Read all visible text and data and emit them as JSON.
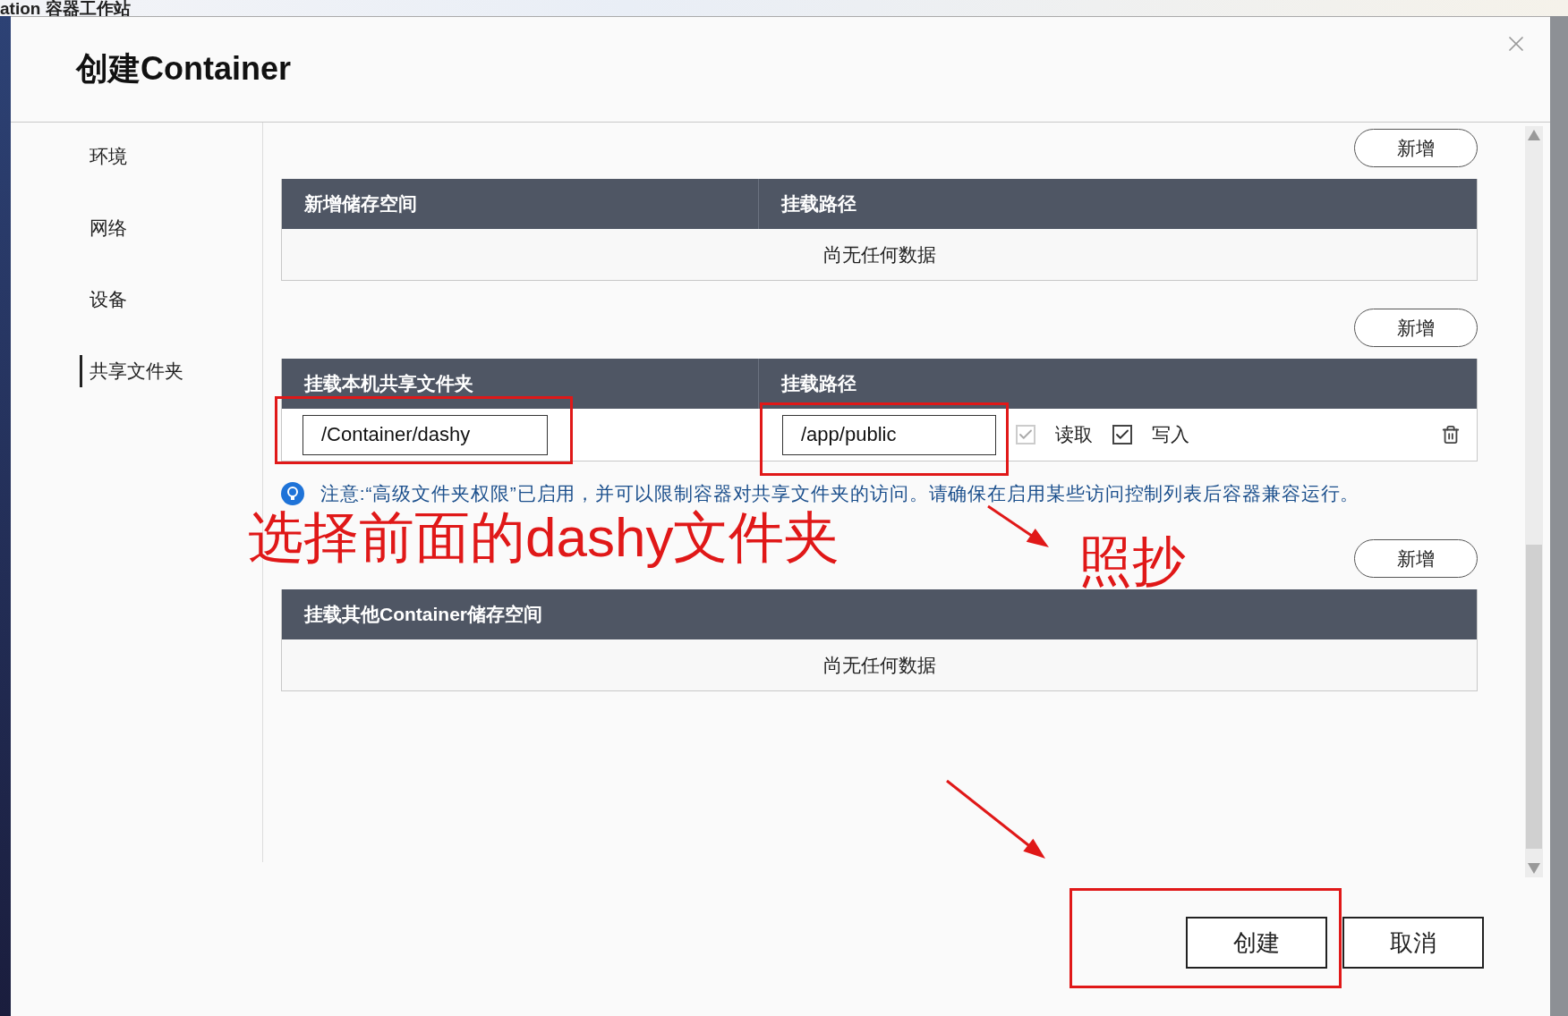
{
  "background_title": "ation 容器工作站",
  "dialog": {
    "title": "创建Container"
  },
  "sidebar": {
    "items": [
      {
        "label": "环境",
        "selected": false
      },
      {
        "label": "网络",
        "selected": false
      },
      {
        "label": "设备",
        "selected": false
      },
      {
        "label": "共享文件夹",
        "selected": true
      }
    ]
  },
  "sections": [
    {
      "add_button": "新增",
      "columns": [
        "新增储存空间",
        "挂载路径"
      ],
      "empty_text": "尚无任何数据"
    },
    {
      "add_button": "新增",
      "columns": [
        "挂载本机共享文件夹",
        "挂载路径"
      ],
      "rows": [
        {
          "host_folder": "/Container/dashy",
          "mount_path": "/app/public",
          "read": {
            "label": "读取",
            "checked": true,
            "disabled": true
          },
          "write": {
            "label": "写入",
            "checked": true,
            "disabled": false
          }
        }
      ],
      "note": "注意:“高级文件夹权限”已启用，并可以限制容器对共享文件夹的访问。请确保在启用某些访问控制列表后容器兼容运行。"
    },
    {
      "add_button": "新增",
      "columns": [
        "挂载其他Container储存空间"
      ],
      "empty_text": "尚无任何数据"
    }
  ],
  "footer": {
    "buttons": [
      "创建",
      "取消"
    ]
  },
  "annotations": [
    {
      "kind": "box"
    },
    {
      "kind": "box"
    },
    {
      "kind": "text",
      "text": "选择前面的dashy文件夹"
    },
    {
      "kind": "arrow"
    },
    {
      "kind": "text",
      "text": "照抄"
    },
    {
      "kind": "arrow"
    },
    {
      "kind": "box"
    }
  ]
}
